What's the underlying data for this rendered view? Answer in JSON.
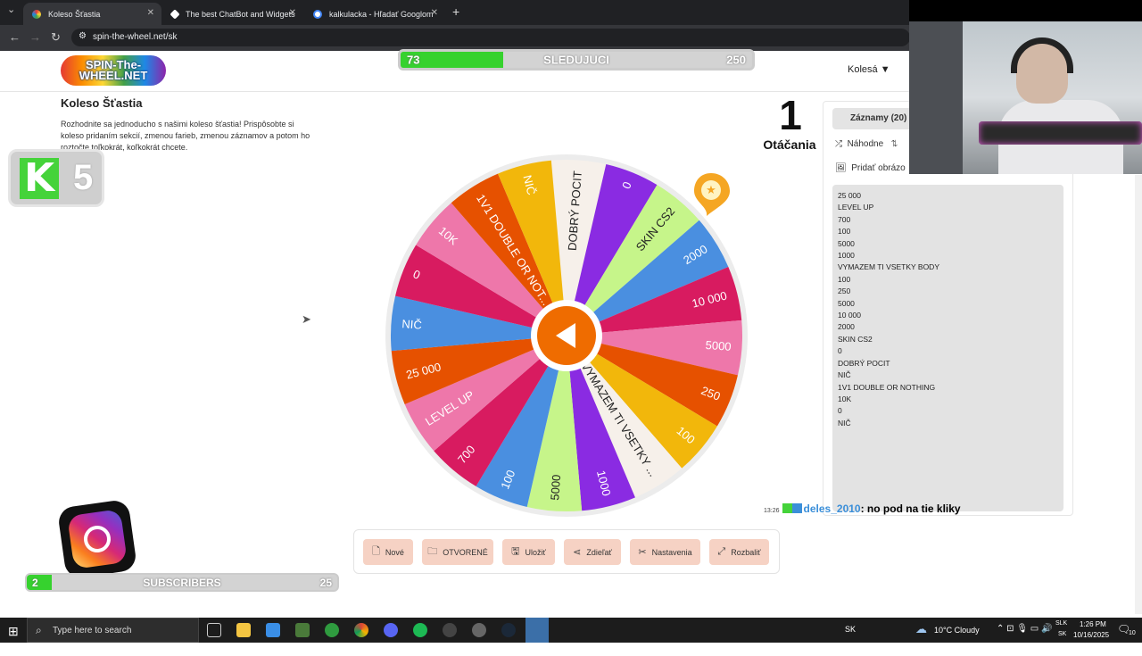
{
  "browser": {
    "tabs": [
      {
        "title": "Koleso Šťastia",
        "active": true
      },
      {
        "title": "The best ChatBot and Widgets",
        "active": false
      },
      {
        "title": "kalkulacka - Hľadať Googlom",
        "active": false
      }
    ],
    "url": "spin-the-wheel.net/sk"
  },
  "header": {
    "logo_text": "SPIN-The-WHEEL.NET",
    "wheels_menu": "Kolesá ▼"
  },
  "follow_goal": {
    "current": "73",
    "label": "SLEDUJUCI",
    "target": "250",
    "progress": 0.292
  },
  "page": {
    "title": "Koleso Šťastia",
    "description": "Rozhodnite sa jednoducho s našimi koleso šťastia! Prispôsobte si koleso pridaním sekcií, zmenou farieb, zmenou záznamov a potom ho roztočte toľkokrát, koľkokrát chcete."
  },
  "kick_badge": {
    "count": "5",
    "logo": "K"
  },
  "spins": {
    "count": "1",
    "label": "Otáčania"
  },
  "wheel": {
    "segments": [
      {
        "label": "DOBRÝ POCIT",
        "color": "#f6f0ea"
      },
      {
        "label": "0",
        "color": "#8a2be2"
      },
      {
        "label": "SKIN CS2",
        "color": "#c6f58a"
      },
      {
        "label": "2000",
        "color": "#4a8fe0"
      },
      {
        "label": "10 000",
        "color": "#d81b60"
      },
      {
        "label": "5000",
        "color": "#ee77aa"
      },
      {
        "label": "250",
        "color": "#e65100"
      },
      {
        "label": "100",
        "color": "#f2b70b"
      },
      {
        "label": "VYMAZEM TI VSETKY ...",
        "color": "#f6f0ea"
      },
      {
        "label": "1000",
        "color": "#8a2be2"
      },
      {
        "label": "5000",
        "color": "#c6f58a"
      },
      {
        "label": "100",
        "color": "#4a8fe0"
      },
      {
        "label": "700",
        "color": "#d81b60"
      },
      {
        "label": "LEVEL UP",
        "color": "#ee77aa"
      },
      {
        "label": "25 000",
        "color": "#e65100"
      },
      {
        "label": "NIČ",
        "color": "#4a8fe0"
      },
      {
        "label": "0",
        "color": "#d81b60"
      },
      {
        "label": "10K",
        "color": "#ee77aa"
      },
      {
        "label": "1V1 DOUBLE OR NOT...",
        "color": "#e65100"
      },
      {
        "label": "NIČ",
        "color": "#f2b70b"
      }
    ],
    "rim_color": "#ececec",
    "hub_color": "#ef6c00"
  },
  "actions": [
    {
      "label": "Nové",
      "icon": "file-icon"
    },
    {
      "label": "OTVORENÉ",
      "icon": "folder-icon"
    },
    {
      "label": "Uložiť",
      "icon": "save-icon"
    },
    {
      "label": "Zdieľať",
      "icon": "share-icon"
    },
    {
      "label": "Nastavenia",
      "icon": "settings-icon"
    },
    {
      "label": "Rozbaliť",
      "icon": "expand-icon"
    }
  ],
  "sidebar": {
    "tab_label": "Záznamy (20)",
    "random_label": "Náhodne",
    "add_image_label": "Pridať obrázo",
    "entries": [
      "25 000",
      "LEVEL UP",
      "700",
      "100",
      "5000",
      "1000",
      "VYMAZEM TI VSETKY BODY",
      "100",
      "250",
      "5000",
      "10 000",
      "2000",
      "SKIN CS2",
      "0",
      "DOBRÝ POCIT",
      "NIČ",
      "1V1 DOUBLE OR NOTHING",
      "10K",
      "0",
      "NIČ"
    ]
  },
  "chat": {
    "time": "13:26",
    "user": "deles_2010",
    "message": ": no pod na tie kliky"
  },
  "subscribers": {
    "current": "2",
    "label": "SUBSCRIBERS",
    "target": "25",
    "progress": 0.08
  },
  "taskbar": {
    "search_placeholder": "Type here to search",
    "weather": "10°C  Cloudy",
    "lang": "SK",
    "lang2": "SLK",
    "lang3": "SK",
    "time": "1:26 PM",
    "date": "10/16/2025",
    "notif_count": "10"
  }
}
